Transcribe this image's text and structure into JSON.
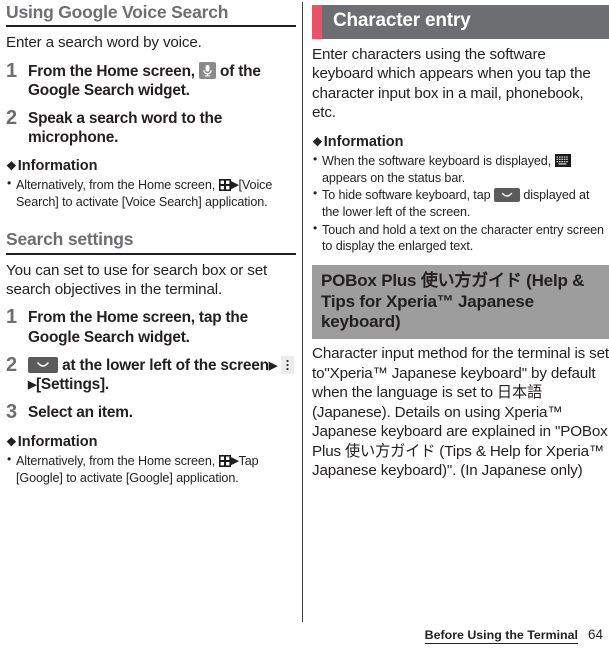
{
  "left_column": {
    "section1": {
      "title": "Using Google Voice Search",
      "intro": "Enter a search word by voice.",
      "steps": [
        {
          "num": "1",
          "text_before": "From the Home screen,",
          "icon": "microphone-icon",
          "text_after": "of the Google Search widget."
        },
        {
          "num": "2",
          "text": "Speak a search word to the microphone."
        }
      ],
      "information_label": "Information",
      "information_items": [
        {
          "before": "Alternatively, from the Home screen,",
          "icon": "app-grid-icon",
          "arrow": "▶",
          "after": "[Voice Search] to activate [Voice Search] application."
        }
      ]
    },
    "section2": {
      "title": "Search settings",
      "intro": "You can set to use for search box or set search objectives in the terminal.",
      "steps": [
        {
          "num": "1",
          "text": "From the Home screen, tap the Google Search widget."
        },
        {
          "num": "2",
          "icon1": "chevron-down-key-icon",
          "mid": "at the lower left of the screen",
          "arrow1": "▶",
          "icon2": "overflow-menu-icon",
          "arrow2": "▶",
          "end": "[Settings]."
        },
        {
          "num": "3",
          "text": "Select an item."
        }
      ],
      "information_label": "Information",
      "information_items": [
        {
          "before": "Alternatively, from the Home screen,",
          "icon": "app-grid-icon",
          "arrow": "▶",
          "after": "Tap [Google] to activate [Google] application."
        }
      ]
    }
  },
  "right_column": {
    "banner": {
      "title": "Character entry",
      "accent_color": "#e8536a",
      "background_color": "#6d6e71"
    },
    "intro": "Enter characters using the software keyboard which appears when you tap the character input box in a mail, phonebook, etc.",
    "information_label": "Information",
    "information_items": [
      {
        "before": "When the software keyboard is displayed,",
        "icon": "keyboard-icon",
        "after": "appears on the status bar."
      },
      {
        "before": "To hide software keyboard, tap",
        "icon": "chevron-down-key-icon",
        "after": "displayed at the lower left of the screen."
      },
      {
        "text": "Touch and hold a text on the character entry screen to display the enlarged text."
      }
    ],
    "gray_banner": {
      "title": "POBox Plus 使い方ガイド (Help & Tips for Xperia™ Japanese keyboard)",
      "background_color": "#9d9d9d"
    },
    "body": "Character input method for the terminal is set to\"Xperia™ Japanese keyboard\" by default when the language is set to 日本語 (Japanese). Details on using Xperia™ Japanese keyboard are explained in \"POBox Plus 使い方ガイド (Tips & Help for Xperia™ Japanese keyboard)\". (In Japanese only)"
  },
  "footer": {
    "chapter": "Before Using the Terminal",
    "page_number": "64"
  }
}
